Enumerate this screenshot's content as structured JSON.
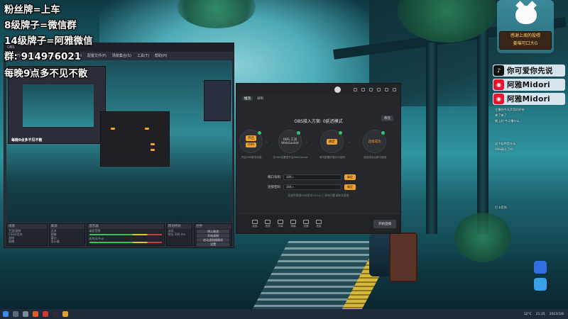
{
  "overlay": {
    "line1": "粉丝牌=上车",
    "line2": "8级牌子=微信群",
    "line3": "14级牌子=阿雅微信",
    "line4": "群: 914976021",
    "line5": "每晚9点多不见不散"
  },
  "obs": {
    "title_left": "OBS",
    "menu": [
      "文件(F)",
      "编辑(E)",
      "视图(V)",
      "停靠部件(D)",
      "配置文件(P)",
      "场景集合(S)",
      "工具(T)",
      "帮助(H)"
    ],
    "nested_overlay": [
      "粉丝牌=上车",
      "每晚9点多不见不散"
    ],
    "docks": {
      "scenes": {
        "header": "场景",
        "items": [
          "手游/录制",
          "CSGO竞技",
          "游戏",
          "直播"
        ]
      },
      "sources": {
        "header": "来源",
        "items": [
          "文本",
          "图像",
          "窗口",
          "显示器"
        ]
      },
      "mixer": {
        "header": "混音器",
        "items": [
          "桌面音频",
          "麦克风/Aux",
          "媒体源"
        ]
      },
      "transitions": {
        "header": "转场特效",
        "items": [
          "淡出",
          "时长 300 ms"
        ]
      },
      "controls": {
        "header": "控件",
        "items": [
          "停止推流",
          "开始录制",
          "启动虚拟摄像机",
          "工作室模式",
          "设置",
          "退出"
        ]
      }
    },
    "status": "LIVE: 00:00:00   REC: 00:00:00   CPU: 3.0%, 60.00 fps"
  },
  "recorder": {
    "tabs": [
      "推流",
      "录制"
    ],
    "mode_title": "OBS接入方案: 0延迟模式",
    "guide": "教程",
    "steps": [
      {
        "b1": "开启",
        "b2": "OBS",
        "caption": "开启OBS推流功能"
      },
      {
        "t1": "OBS 工具",
        "t2": "WebSocket",
        "caption": "在OBS设置里开启WebSocket"
      },
      {
        "b1": "确定",
        "caption": "填写配置的端口与密码"
      },
      {
        "t1": "连接成功",
        "caption": "连接成功后即可使用"
      }
    ],
    "port_label": "端口号码",
    "password_label": "连接密码",
    "field_placeholder": "请输入",
    "confirm": "确定",
    "hint": "此插件需要OBS版本28.0以上 如有问题请联系客服",
    "bottom_tools": [
      "画面",
      "音频",
      "字幕",
      "弹幕",
      "设置",
      "音量"
    ],
    "start": "开始直播"
  },
  "right_panel": {
    "sign_top": "感谢上周的投喂",
    "sign_bottom": "姜喵可口大G",
    "badges": [
      {
        "icon": "tiktok-icon",
        "text": "你可爱你先说",
        "color": "#111111"
      },
      {
        "icon": "weibo-icon",
        "text": "阿雅Midori",
        "color": "#e6162d"
      },
      {
        "icon": "weibo-icon",
        "text": "阿雅Midori",
        "color": "#e6162d"
      }
    ],
    "chat": [
      "主播你今天声音好好听",
      "来了来了",
      "晚上好 今天播什么",
      "这个软件是什么",
      "OBS接入了吗",
      "打卡签到"
    ]
  },
  "taskbar": {
    "time": "21:35",
    "date": "2023/3/8",
    "weather": "12°C"
  },
  "colors": {
    "accent": "#f2a12e",
    "online": "#2ec56a",
    "panel": "#25272c"
  }
}
